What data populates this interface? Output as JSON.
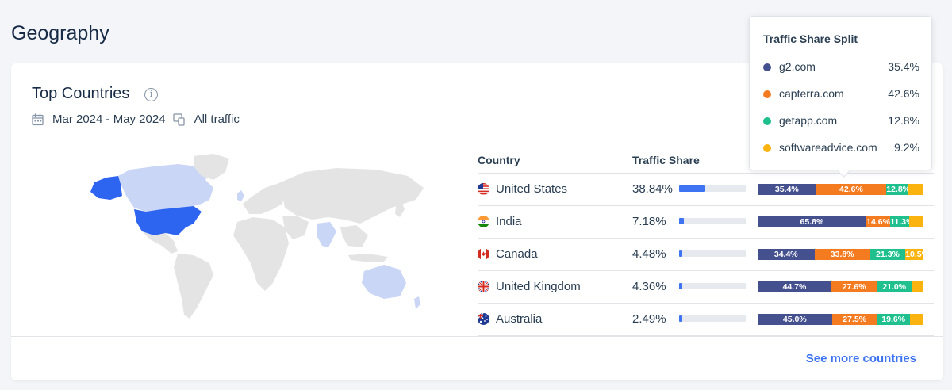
{
  "page": {
    "title": "Geography"
  },
  "card": {
    "title": "Top Countries",
    "info_icon": "info-icon",
    "date_range": "Mar 2024 - May 2024",
    "traffic_type": "All traffic",
    "see_more": "See more countries"
  },
  "table": {
    "headers": {
      "country": "Country",
      "share": "Traffic Share"
    },
    "rows": [
      {
        "country": "United States",
        "flag": "us-flag-icon",
        "share": "38.84%",
        "share_value": 0.3884,
        "split": [
          {
            "label": "35.4%",
            "value": 35.4
          },
          {
            "label": "42.6%",
            "value": 42.6
          },
          {
            "label": "12.8%",
            "value": 12.8
          },
          {
            "label": "",
            "value": 9.2
          }
        ]
      },
      {
        "country": "India",
        "flag": "india-flag-icon",
        "share": "7.18%",
        "share_value": 0.0718,
        "split": [
          {
            "label": "65.8%",
            "value": 65.8
          },
          {
            "label": "14.6%",
            "value": 14.6
          },
          {
            "label": "11.3%",
            "value": 11.3
          },
          {
            "label": "",
            "value": 8.3
          }
        ]
      },
      {
        "country": "Canada",
        "flag": "canada-flag-icon",
        "share": "4.48%",
        "share_value": 0.0448,
        "split": [
          {
            "label": "34.4%",
            "value": 34.4
          },
          {
            "label": "33.8%",
            "value": 33.8
          },
          {
            "label": "21.3%",
            "value": 21.3
          },
          {
            "label": "10.5%",
            "value": 10.5
          }
        ]
      },
      {
        "country": "United Kingdom",
        "flag": "uk-flag-icon",
        "share": "4.36%",
        "share_value": 0.0436,
        "split": [
          {
            "label": "44.7%",
            "value": 44.7
          },
          {
            "label": "27.6%",
            "value": 27.6
          },
          {
            "label": "21.0%",
            "value": 21.0
          },
          {
            "label": "",
            "value": 6.7
          }
        ]
      },
      {
        "country": "Australia",
        "flag": "australia-flag-icon",
        "share": "2.49%",
        "share_value": 0.0249,
        "split": [
          {
            "label": "45.0%",
            "value": 45.0
          },
          {
            "label": "27.5%",
            "value": 27.5
          },
          {
            "label": "19.6%",
            "value": 19.6
          },
          {
            "label": "",
            "value": 7.9
          }
        ]
      }
    ]
  },
  "tooltip": {
    "title": "Traffic Share Split",
    "items": [
      {
        "label": "g2.com",
        "value": "35.4%",
        "color": "#45508f"
      },
      {
        "label": "capterra.com",
        "value": "42.6%",
        "color": "#f47b20"
      },
      {
        "label": "getapp.com",
        "value": "12.8%",
        "color": "#1fc08e"
      },
      {
        "label": "softwareadvice.com",
        "value": "9.2%",
        "color": "#fbb30f"
      }
    ]
  },
  "colors": {
    "accent": "#3e74f1",
    "map_highlight": "#2d64f0",
    "map_light": "#c9d6f6",
    "map_base": "#e4e4e4"
  }
}
